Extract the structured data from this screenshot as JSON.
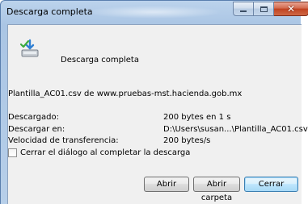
{
  "window": {
    "title": "Descarga completa"
  },
  "dialog": {
    "icon": "download-complete-icon",
    "heading": "Descarga completa",
    "file_line": "Plantilla_AC01.csv de www.pruebas-mst.hacienda.gob.mx",
    "details": [
      {
        "label": "Descargado:",
        "value": "200 bytes en 1 s"
      },
      {
        "label": "Descargar en:",
        "value": "D:\\Users\\susan...\\Plantilla_AC01.csv"
      },
      {
        "label": "Velocidad de transferencia:",
        "value": "200 bytes/s"
      }
    ],
    "close_when_done": {
      "label": "Cerrar el diálogo al completar la descarga",
      "checked": false
    }
  },
  "buttons": {
    "open": "Abrir",
    "open_folder": "Abrir carpeta",
    "close": "Cerrar"
  },
  "caption_buttons": {
    "minimize": "minimize-icon",
    "maximize": "maximize-icon",
    "close": "close-icon"
  }
}
